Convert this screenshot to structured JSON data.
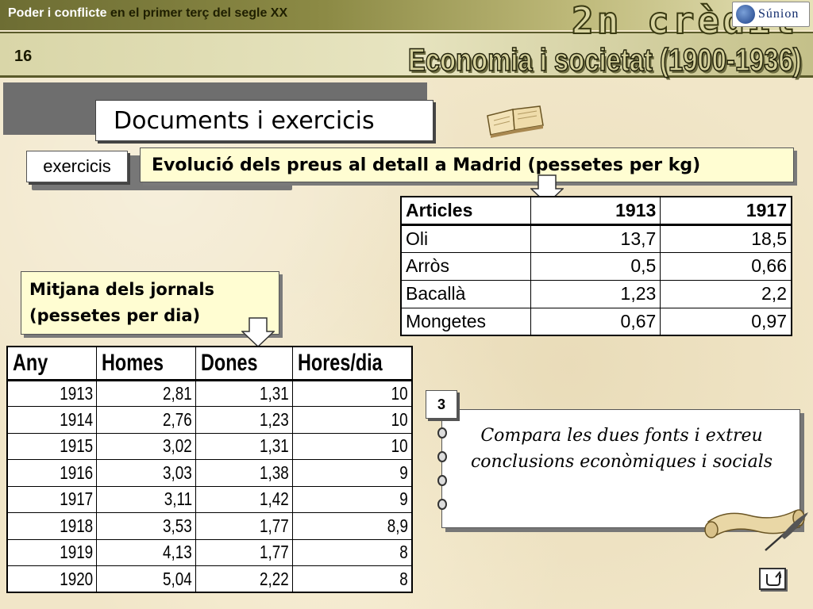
{
  "header": {
    "subject_part1": "Poder i conflicte",
    "subject_part2": "en el primer terç del segle XX",
    "credit": "2n crèdit",
    "logo_text": "Súnion",
    "page_number": "16",
    "title": "Economia i societat (1900-1936)"
  },
  "section": {
    "heading": "Documents i exercicis",
    "tab_label": "exercicis",
    "prices_title": "Evolució dels preus al detall a Madrid (pessetes per kg)"
  },
  "prices_table": {
    "headers": [
      "Articles",
      "1913",
      "1917"
    ],
    "rows": [
      [
        "Oli",
        "13,7",
        "18,5"
      ],
      [
        "Arròs",
        "0,5",
        "0,66"
      ],
      [
        "Bacallà",
        "1,23",
        "2,2"
      ],
      [
        "Mongetes",
        "0,67",
        "0,97"
      ]
    ]
  },
  "wages": {
    "caption": "Mitjana dels jornals\n(pessetes per dia)",
    "headers": [
      "Any",
      "Homes",
      "Dones",
      "Hores/dia"
    ],
    "rows": [
      [
        "1913",
        "2,81",
        "1,31",
        "10"
      ],
      [
        "1914",
        "2,76",
        "1,23",
        "10"
      ],
      [
        "1915",
        "3,02",
        "1,31",
        "10"
      ],
      [
        "1916",
        "3,03",
        "1,38",
        "9"
      ],
      [
        "1917",
        "3,11",
        "1,42",
        "9"
      ],
      [
        "1918",
        "3,53",
        "1,77",
        "8,9"
      ],
      [
        "1919",
        "4,13",
        "1,77",
        "8"
      ],
      [
        "1920",
        "5,04",
        "2,22",
        "8"
      ]
    ]
  },
  "exercise": {
    "number": "3",
    "text": "Compara les dues fonts i extreu conclusions econòmiques i socials"
  },
  "icons": {
    "book": "open-book-icon",
    "scroll": "scroll-quill-icon",
    "return": "return-arrow-icon",
    "logo": "sunion-logo-icon"
  }
}
